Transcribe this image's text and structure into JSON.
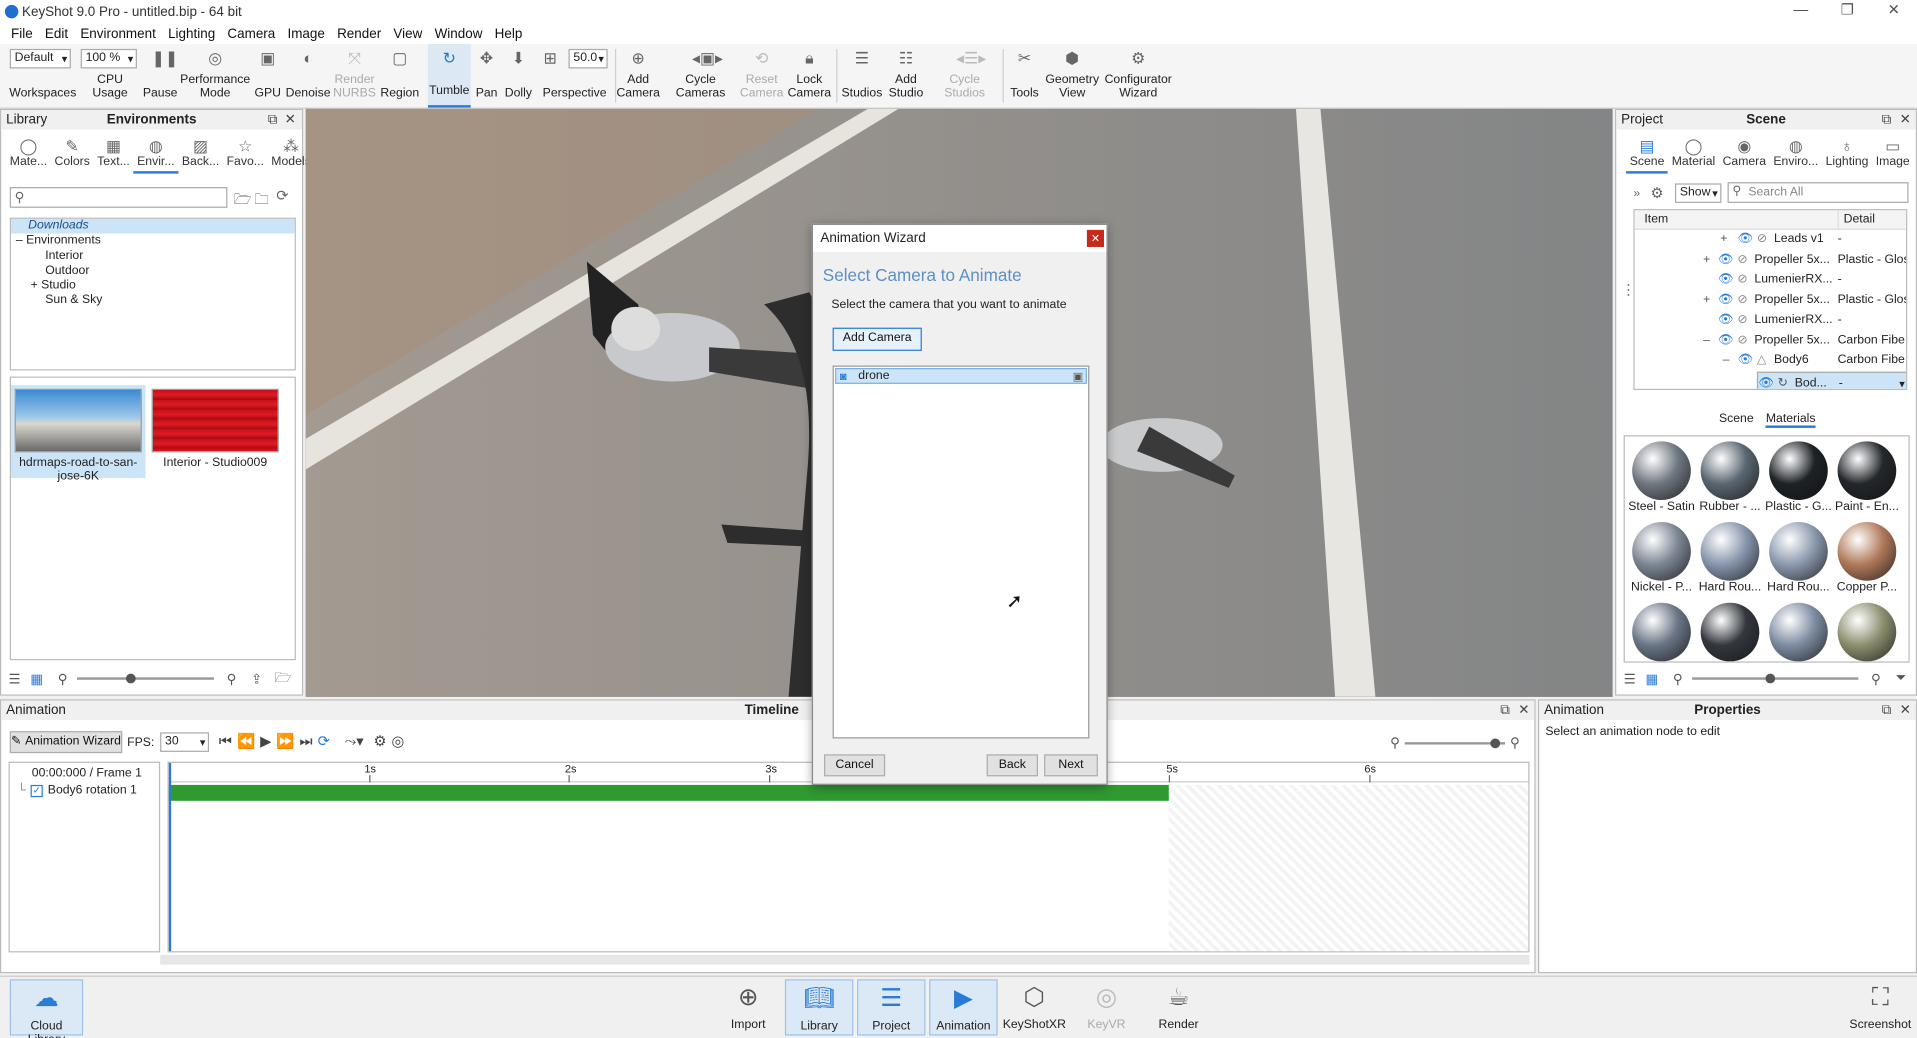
{
  "window": {
    "title": "KeyShot 9.0 Pro - untitled.bip - 64 bit",
    "controls": [
      "—",
      "❐",
      "✕"
    ]
  },
  "menu": [
    "File",
    "Edit",
    "Environment",
    "Lighting",
    "Camera",
    "Image",
    "Render",
    "View",
    "Window",
    "Help"
  ],
  "toolbar": {
    "workspace_value": "Default",
    "cpu_value": "100 %",
    "focal_value": "50.0",
    "items": [
      {
        "label": "Workspaces",
        "icon": "workspaces-icon"
      },
      {
        "label": "CPU Usage",
        "icon": "cpu-icon"
      },
      {
        "label": "Pause",
        "icon": "pause-icon"
      },
      {
        "label": "Performance\nMode",
        "icon": "performance-icon"
      },
      {
        "label": "GPU",
        "icon": "gpu-icon"
      },
      {
        "label": "Denoise",
        "icon": "denoise-icon"
      },
      {
        "label": "Render\nNURBS",
        "icon": "nurbs-icon"
      },
      {
        "label": "Region",
        "icon": "region-icon"
      },
      {
        "label": "Tumble",
        "icon": "tumble-icon"
      },
      {
        "label": "Pan",
        "icon": "pan-icon"
      },
      {
        "label": "Dolly",
        "icon": "dolly-icon"
      },
      {
        "label": "Perspective",
        "icon": "perspective-icon"
      },
      {
        "label": "Add\nCamera",
        "icon": "add-camera-icon"
      },
      {
        "label": "Cycle\nCameras",
        "icon": "cycle-cameras-icon"
      },
      {
        "label": "Reset\nCamera",
        "icon": "reset-camera-icon"
      },
      {
        "label": "Lock\nCamera",
        "icon": "lock-camera-icon"
      },
      {
        "label": "Studios",
        "icon": "studios-icon"
      },
      {
        "label": "Add\nStudio",
        "icon": "add-studio-icon"
      },
      {
        "label": "Cycle\nStudios",
        "icon": "cycle-studios-icon"
      },
      {
        "label": "Tools",
        "icon": "tools-icon"
      },
      {
        "label": "Geometry\nView",
        "icon": "geometry-view-icon"
      },
      {
        "label": "Configurator\nWizard",
        "icon": "configurator-icon"
      }
    ]
  },
  "library": {
    "header_left": "Library",
    "header_title": "Environments",
    "tabs": [
      "Mate...",
      "Colors",
      "Text...",
      "Envir...",
      "Back...",
      "Favo...",
      "Models"
    ],
    "search_placeholder": "",
    "tree": [
      "Downloads",
      "Environments",
      "Interior",
      "Outdoor",
      "Studio",
      "Sun & Sky"
    ],
    "thumbs": [
      {
        "label": "hdrmaps-road-to-san-jose-6K"
      },
      {
        "label": "Interior - Studio009"
      }
    ]
  },
  "project": {
    "header_left": "Project",
    "header_title": "Scene",
    "tabs": [
      "Scene",
      "Material",
      "Camera",
      "Enviro...",
      "Lighting",
      "Image"
    ],
    "show_label": "Show",
    "search_placeholder": "Search All",
    "col_item": "Item",
    "col_detail": "Detail",
    "rows": [
      {
        "name": "Leads v1",
        "detail": "-"
      },
      {
        "name": "Propeller 5x...",
        "detail": "Plastic - Glos"
      },
      {
        "name": "LumenierRX...",
        "detail": "-"
      },
      {
        "name": "Propeller 5x...",
        "detail": "Plastic - Glos"
      },
      {
        "name": "LumenierRX...",
        "detail": "-"
      },
      {
        "name": "Propeller 5x...",
        "detail": "Carbon Fibe"
      },
      {
        "name": "Body6",
        "detail": "Carbon Fibe"
      },
      {
        "name": "Bod...",
        "detail": "-"
      }
    ],
    "subtabs": [
      "Scene",
      "Materials"
    ],
    "materials": [
      {
        "label": "Steel - Satin",
        "color": "#6f7880"
      },
      {
        "label": "Rubber - ...",
        "color": "#5a6670"
      },
      {
        "label": "Plastic - G...",
        "color": "#1d2226"
      },
      {
        "label": "Paint - En...",
        "color": "#23272b"
      },
      {
        "label": "Nickel - P...",
        "color": "#7d8794"
      },
      {
        "label": "Hard Rou...",
        "color": "#8796ad"
      },
      {
        "label": "Hard Rou...",
        "color": "#8c99ae"
      },
      {
        "label": "Copper P...",
        "color": "#b07a5a"
      },
      {
        "label": "",
        "color": "#6a7686"
      },
      {
        "label": "",
        "color": "#33383e"
      },
      {
        "label": "",
        "color": "#7e8ca2"
      },
      {
        "label": "",
        "color": "#8d8f70"
      }
    ]
  },
  "dialog": {
    "title": "Animation Wizard",
    "heading": "Select Camera to Animate",
    "description": "Select the camera that you want to animate",
    "add_camera": "Add Camera",
    "cameras": [
      "drone"
    ],
    "cancel": "Cancel",
    "back": "Back",
    "next": "Next"
  },
  "animation": {
    "header_left": "Animation",
    "header_title": "Timeline",
    "wizard_button": "Animation Wizard",
    "fps_label": "FPS:",
    "fps_value": "30",
    "time_readout": "00:00:000 / Frame 1",
    "track_name": "Body6 rotation 1",
    "ruler": [
      "1s",
      "2s",
      "3s",
      "5s",
      "6s"
    ]
  },
  "properties": {
    "header_left": "Animation",
    "header_title": "Properties",
    "message": "Select an animation node to edit"
  },
  "bottombar": {
    "cloud_library": "Cloud Library",
    "items": [
      "Import",
      "Library",
      "Project",
      "Animation",
      "KeyShotXR",
      "KeyVR",
      "Render"
    ],
    "screenshot": "Screenshot"
  },
  "colors": {
    "accent": "#2a7bd6",
    "track": "#2f9a2f",
    "selection": "#cce4f7"
  }
}
